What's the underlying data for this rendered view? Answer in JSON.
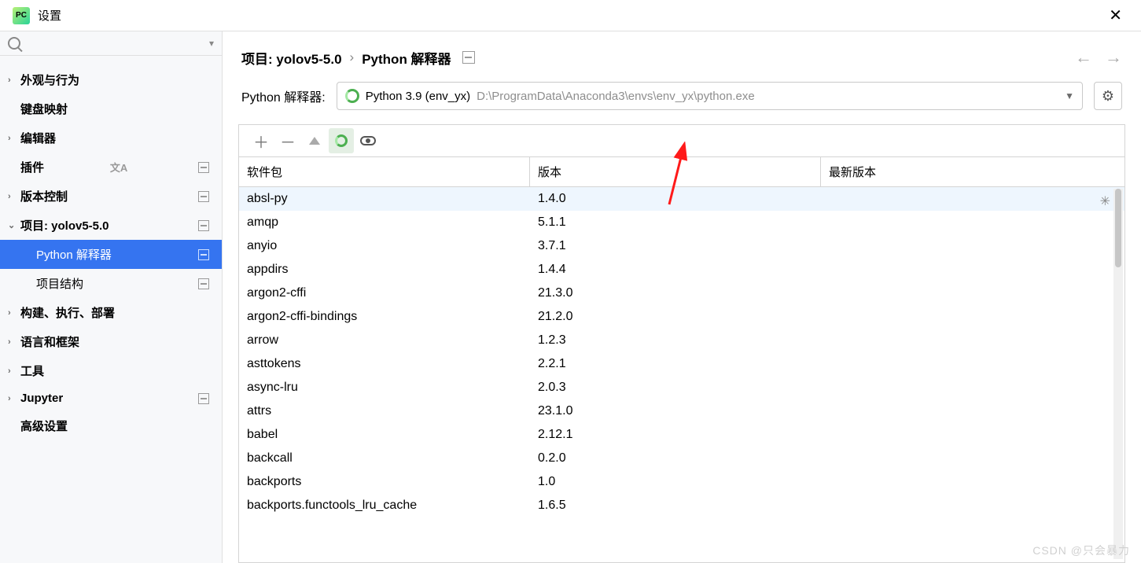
{
  "titlebar": {
    "title": "设置",
    "pc": "PC"
  },
  "search": {
    "placeholder": ""
  },
  "sidebar": {
    "items": [
      {
        "caret": "›",
        "label": "外观与行为",
        "bold": true
      },
      {
        "caret": "",
        "label": "键盘映射",
        "bold": true
      },
      {
        "caret": "›",
        "label": "编辑器",
        "bold": true
      },
      {
        "caret": "",
        "label": "插件",
        "bold": true,
        "lang": true,
        "box": true
      },
      {
        "caret": "›",
        "label": "版本控制",
        "bold": true,
        "box": true
      },
      {
        "caret": "⌄",
        "label": "项目: yolov5-5.0",
        "bold": true,
        "box": true
      },
      {
        "caret": "",
        "label": "Python 解释器",
        "bold": false,
        "level": 2,
        "selected": true,
        "box": true
      },
      {
        "caret": "",
        "label": "项目结构",
        "bold": false,
        "level": 2,
        "box": true
      },
      {
        "caret": "›",
        "label": "构建、执行、部署",
        "bold": true
      },
      {
        "caret": "›",
        "label": "语言和框架",
        "bold": true
      },
      {
        "caret": "›",
        "label": "工具",
        "bold": true
      },
      {
        "caret": "›",
        "label": "Jupyter",
        "bold": true,
        "box": true
      },
      {
        "caret": "",
        "label": "高级设置",
        "bold": true
      }
    ]
  },
  "breadcrumb": {
    "a": "项目: yolov5-5.0",
    "sep": "›",
    "b": "Python 解释器"
  },
  "interpreter": {
    "label": "Python 解释器:",
    "name": "Python 3.9 (env_yx)",
    "path": "D:\\ProgramData\\Anaconda3\\envs\\env_yx\\python.exe"
  },
  "columns": {
    "name": "软件包",
    "version": "版本",
    "latest": "最新版本"
  },
  "packages": [
    {
      "name": "absl-py",
      "version": "1.4.0",
      "sel": true
    },
    {
      "name": "amqp",
      "version": "5.1.1"
    },
    {
      "name": "anyio",
      "version": "3.7.1"
    },
    {
      "name": "appdirs",
      "version": "1.4.4"
    },
    {
      "name": "argon2-cffi",
      "version": "21.3.0"
    },
    {
      "name": "argon2-cffi-bindings",
      "version": "21.2.0"
    },
    {
      "name": "arrow",
      "version": "1.2.3"
    },
    {
      "name": "asttokens",
      "version": "2.2.1"
    },
    {
      "name": "async-lru",
      "version": "2.0.3"
    },
    {
      "name": "attrs",
      "version": "23.1.0"
    },
    {
      "name": "babel",
      "version": "2.12.1"
    },
    {
      "name": "backcall",
      "version": "0.2.0"
    },
    {
      "name": "backports",
      "version": "1.0"
    },
    {
      "name": "backports.functools_lru_cache",
      "version": "1.6.5"
    }
  ],
  "watermark": "CSDN @只会暴力"
}
